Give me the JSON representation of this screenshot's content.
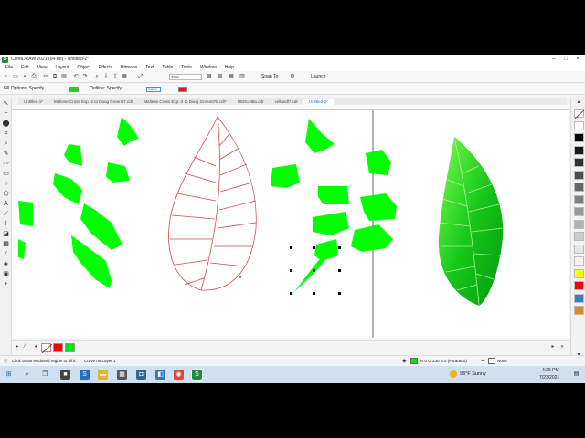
{
  "titlebar": {
    "title": "CorelDRAW 2021 (64-Bit) - Untitled-2*",
    "app_glyph": "S"
  },
  "menu": [
    "File",
    "Edit",
    "View",
    "Layout",
    "Object",
    "Effects",
    "Bitmaps",
    "Text",
    "Table",
    "Tools",
    "Window",
    "Help"
  ],
  "toolbar": {
    "zoom": "32%",
    "snap_to": "Snap To",
    "launch": "Launch"
  },
  "propbar": {
    "fill_options": "Fill Options: Specify",
    "outline": "Outline: Specify",
    "outline_width": "none",
    "fill_color": "#00e600",
    "outline_color": "#e61919"
  },
  "tabs": [
    {
      "label": "Untitled-1*",
      "active": false
    },
    {
      "label": "Maltese Cross Exp -2 to Doug Green07.cdr",
      "active": false
    },
    {
      "label": "Maltese Cross Exp -2 to Doug Green076.cdr*",
      "active": false
    },
    {
      "label": "REDUNBx.cdr",
      "active": false
    },
    {
      "label": "cellandl7.cdr",
      "active": false
    },
    {
      "label": "Untitled-2*",
      "active": true
    }
  ],
  "status": {
    "hint": "Click on an enclosed region to fill it.",
    "object_info": "Curve on Layer 1",
    "fill_info": "R:0 G:230 B:0 (#00E600)",
    "outline_info": "None"
  },
  "taskbar": {
    "weather": "93°F  Sunny",
    "time": "4:25 PM",
    "date": "7/23/2021"
  },
  "colors": {
    "leaf_green": "#00ff00",
    "outline_red": "#d04a4a"
  },
  "palette_colors": [
    "#ffffff",
    "#ffffff",
    "#000000",
    "#1a1a1a",
    "#333333",
    "#4d4d4d",
    "#666666",
    "#808080",
    "#999999",
    "#b3b3b3",
    "#cccccc",
    "#e6e6e6",
    "#f2f2f2",
    "#ffff00",
    "#ff0000",
    "#3a7fc4",
    "#d98b2b"
  ],
  "bottom_palette": [
    "#ffffff",
    "#ff0000",
    "#00e600"
  ]
}
